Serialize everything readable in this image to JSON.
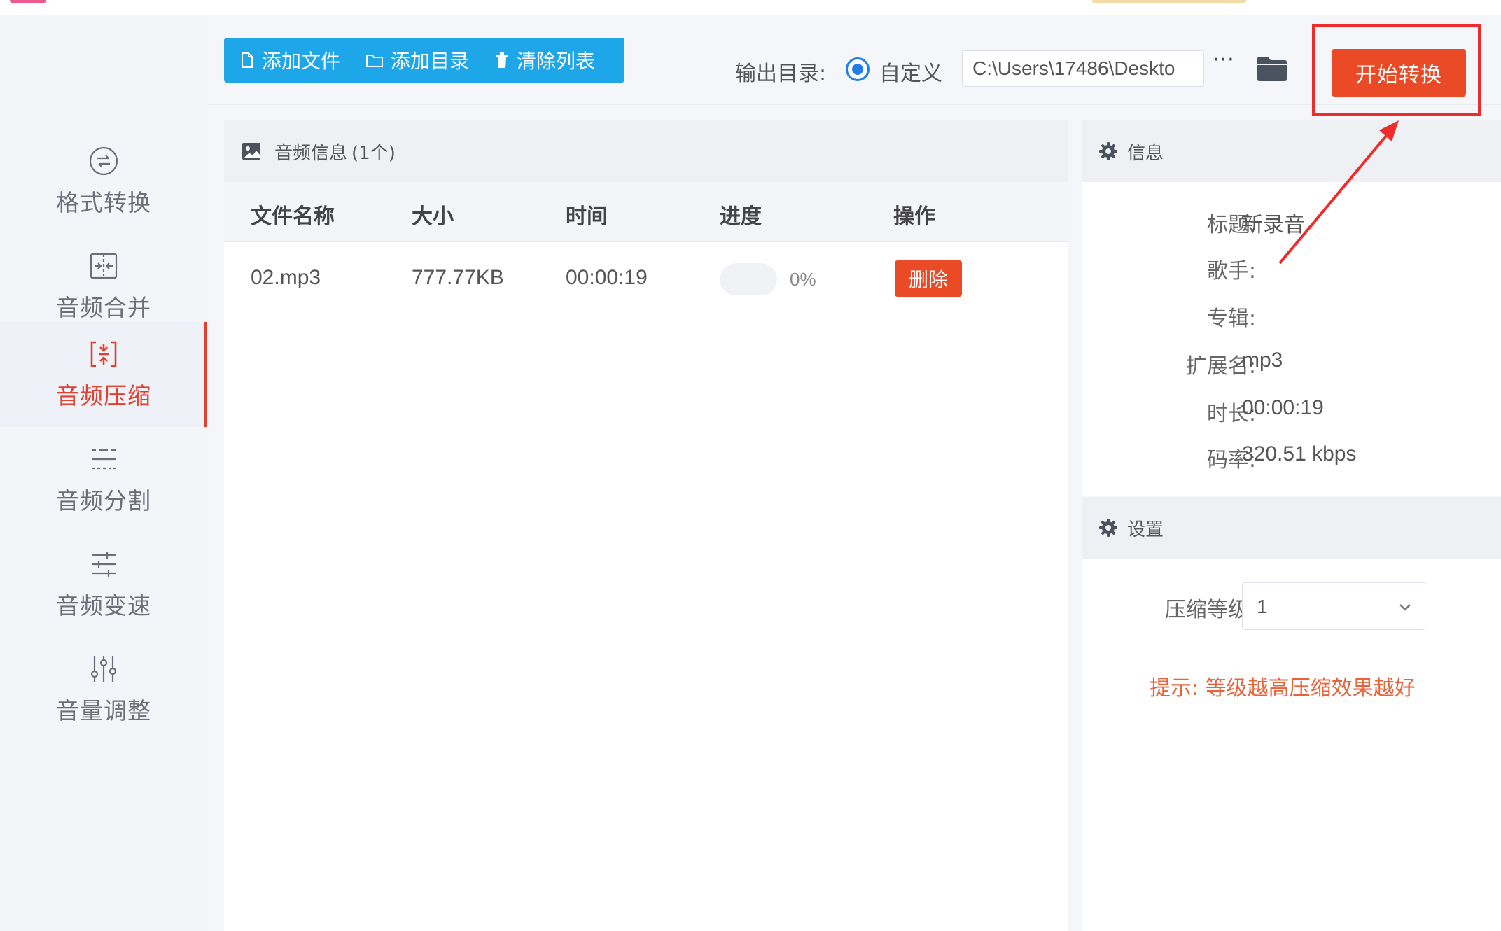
{
  "sidebar": {
    "items": [
      {
        "label": "格式转换",
        "icon": "format-convert-icon",
        "active": false
      },
      {
        "label": "音频合并",
        "icon": "audio-merge-icon",
        "active": false
      },
      {
        "label": "音频压缩",
        "icon": "audio-compress-icon",
        "active": true
      },
      {
        "label": "音频分割",
        "icon": "audio-split-icon",
        "active": false
      },
      {
        "label": "音频变速",
        "icon": "audio-speed-icon",
        "active": false
      },
      {
        "label": "音量调整",
        "icon": "volume-adjust-icon",
        "active": false
      }
    ]
  },
  "toolbar": {
    "add_file": "添加文件",
    "add_folder": "添加目录",
    "clear_list": "清除列表",
    "output_label": "输出目录:",
    "radio_label": "自定义",
    "output_path": "C:\\Users\\17486\\Deskto",
    "more": "···",
    "start_label": "开始转换"
  },
  "audio_panel": {
    "title": "音频信息",
    "count": "(1个)",
    "columns": [
      "文件名称",
      "大小",
      "时间",
      "进度",
      "操作"
    ],
    "rows": [
      {
        "name": "02.mp3",
        "size": "777.77KB",
        "time": "00:00:19",
        "progress": 0,
        "progress_text": "0%",
        "action": "删除"
      }
    ]
  },
  "info_panel": {
    "title": "信息",
    "fields": [
      {
        "key": "标题:",
        "value": "新录音"
      },
      {
        "key": "歌手:",
        "value": ""
      },
      {
        "key": "专辑:",
        "value": ""
      },
      {
        "key": "扩展名:",
        "value": "mp3"
      },
      {
        "key": "时长:",
        "value": "00:00:19"
      },
      {
        "key": "码率:",
        "value": "320.51 kbps"
      }
    ]
  },
  "settings_panel": {
    "title": "设置",
    "level_label": "压缩等级:",
    "level_value": "1",
    "hint": "提示: 等级越高压缩效果越好"
  },
  "colors": {
    "accent_blue": "#1ea7e8",
    "accent_red": "#ea4a25",
    "annotation_red": "#ef2b2b",
    "hint_orange": "#e8623a"
  }
}
